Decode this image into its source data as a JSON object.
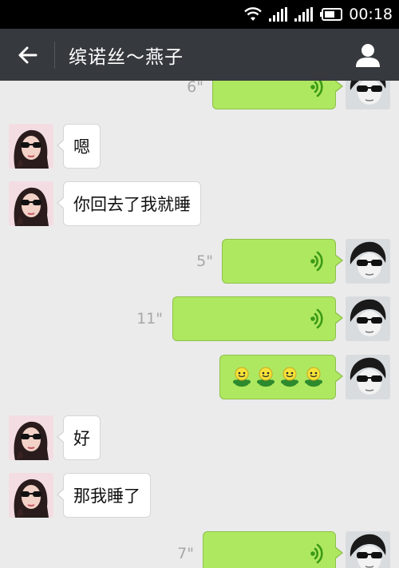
{
  "status_bar": {
    "time": "00:18",
    "icons": [
      "wifi-icon",
      "signal-icon",
      "signal-icon",
      "battery-icon"
    ]
  },
  "header": {
    "title": "缤诺丝～燕子",
    "back_icon": "arrow-left-icon",
    "profile_icon": "person-icon"
  },
  "colors": {
    "header_bg": "#36393e",
    "chat_bg": "#ebebeb",
    "sent_bubble": "#aee860",
    "received_bubble": "#ffffff",
    "duration_text": "#a7a7a7",
    "voice_icon": "#3c9a16"
  },
  "messages": [
    {
      "side": "right",
      "type": "voice",
      "duration": "6\""
    },
    {
      "side": "left",
      "type": "text",
      "text": "嗯"
    },
    {
      "side": "left",
      "type": "text",
      "text": "你回去了我就睡"
    },
    {
      "side": "right",
      "type": "voice",
      "duration": "5\""
    },
    {
      "side": "right",
      "type": "voice",
      "duration": "11\""
    },
    {
      "side": "right",
      "type": "emoji",
      "emoji": "green-smiley-icon",
      "count": 4
    },
    {
      "side": "left",
      "type": "text",
      "text": "好"
    },
    {
      "side": "left",
      "type": "text",
      "text": "那我睡了"
    },
    {
      "side": "right",
      "type": "voice",
      "duration": "7\""
    }
  ]
}
